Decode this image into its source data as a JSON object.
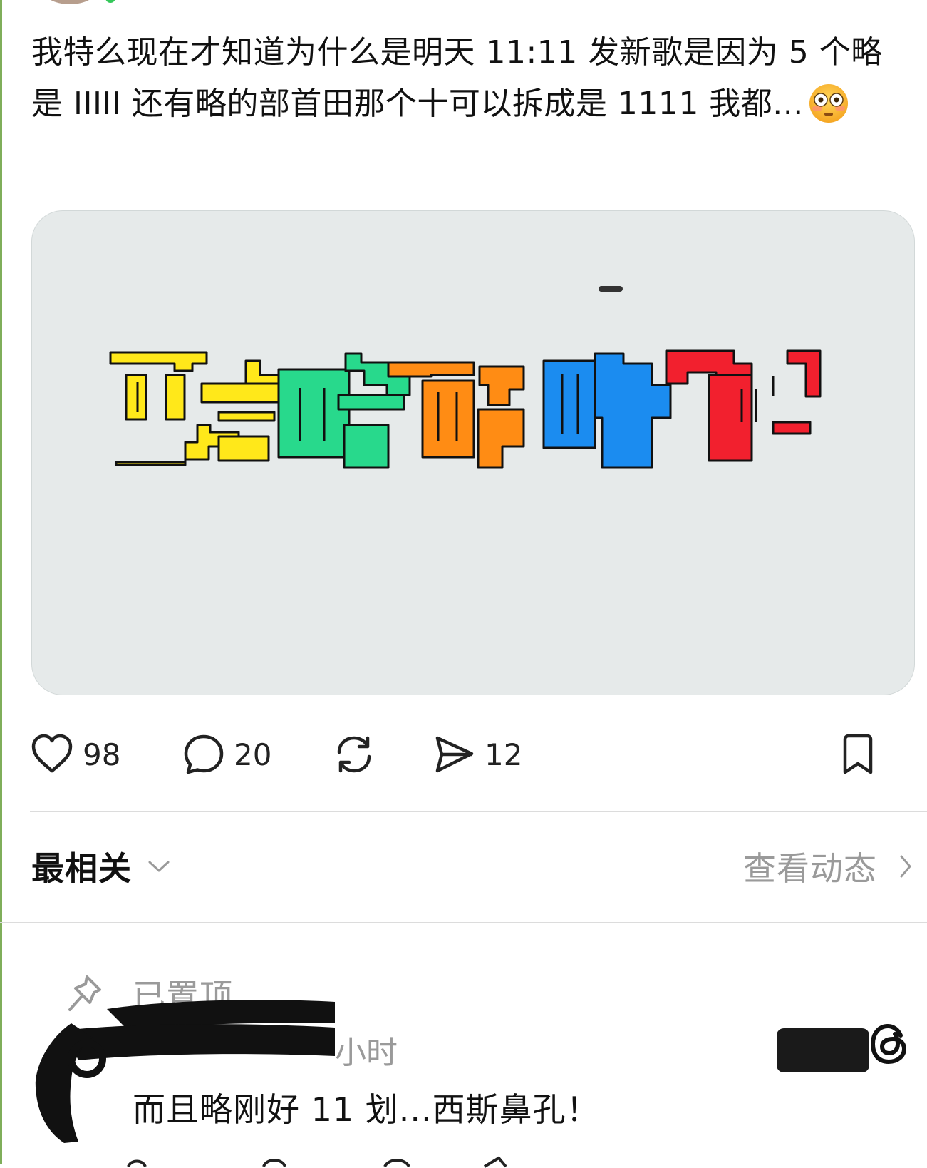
{
  "post": {
    "text": "我特么现在才知道为什么是明天 11:11 发新歌是因为 5 个略是 IIIII 还有略的部首田那个十可以拆成是 1111 我都...",
    "emoji_icon": "flushed-face-emoji"
  },
  "media": {
    "description_icon": "colorful-lue-characters-artwork",
    "glyph_colors": [
      "#ffe81a",
      "#28d98c",
      "#ff8c14",
      "#1b8cf0",
      "#f2202e"
    ]
  },
  "actions": {
    "like_count": "98",
    "comment_count": "20",
    "share_count": "12"
  },
  "sort": {
    "label": "最相关",
    "activity_label": "查看动态"
  },
  "comment": {
    "pinned_label": "已置顶",
    "time": "小时",
    "text": "而且略刚好 11 划...西斯鼻孔！"
  }
}
